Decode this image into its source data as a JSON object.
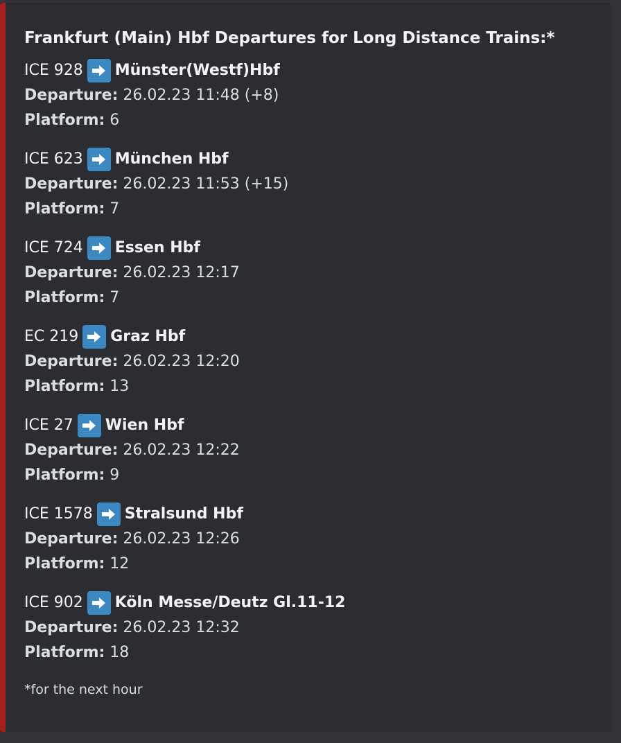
{
  "accent_color": "#a51d1d",
  "icons": {
    "arrow": "right-arrow-icon"
  },
  "title": "Frankfurt (Main) Hbf Departures for Long Distance Trains:*",
  "labels": {
    "departure": "Departure:",
    "platform": "Platform:"
  },
  "trains": [
    {
      "name": "ICE 928",
      "destination": "Münster(Westf)Hbf",
      "departure": "26.02.23 11:48 (+8)",
      "platform": "6"
    },
    {
      "name": "ICE 623",
      "destination": "München Hbf",
      "departure": "26.02.23 11:53 (+15)",
      "platform": "7"
    },
    {
      "name": "ICE 724",
      "destination": "Essen Hbf",
      "departure": "26.02.23 12:17",
      "platform": "7"
    },
    {
      "name": "EC 219",
      "destination": "Graz Hbf",
      "departure": "26.02.23 12:20",
      "platform": "13"
    },
    {
      "name": "ICE 27",
      "destination": "Wien Hbf",
      "departure": "26.02.23 12:22",
      "platform": "9"
    },
    {
      "name": "ICE 1578",
      "destination": "Stralsund Hbf",
      "departure": "26.02.23 12:26",
      "platform": "12"
    },
    {
      "name": "ICE 902",
      "destination": "Köln Messe/Deutz Gl.11-12",
      "departure": "26.02.23 12:32",
      "platform": "18"
    }
  ],
  "footer": "*for the next hour"
}
